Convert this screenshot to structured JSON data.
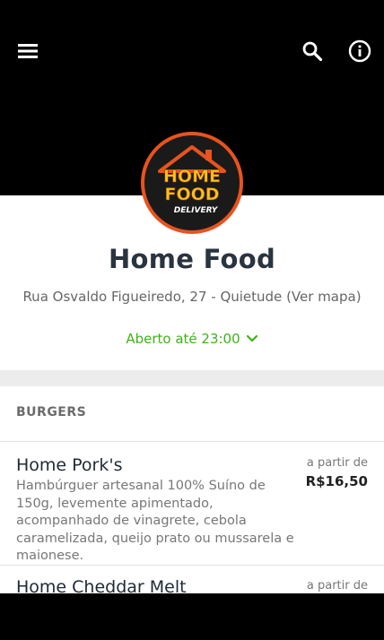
{
  "header": {
    "menu_icon": "hamburger-menu-icon",
    "search_icon": "search-icon",
    "info_icon": "info-icon",
    "logo": {
      "line1": "HOME",
      "line2": "FOOD",
      "line3": "DELIVERY"
    }
  },
  "restaurant": {
    "name": "Home Food",
    "address": "Rua Osvaldo Figueiredo, 27 - Quietude",
    "map_link": "(Ver mapa)",
    "hours": "Aberto até 23:00"
  },
  "section": {
    "title": "BURGERS"
  },
  "items": [
    {
      "name": "Home Pork's",
      "description": "Hambúrguer artesanal 100% Suíno de 150g, levemente apimentado, acompanhado de vinagrete, cebola caramelizada, queijo prato ou mussarela e maionese.",
      "price_prefix": "a partir de",
      "price": "R$16,50"
    },
    {
      "name": "Home Cheddar Melt",
      "price_prefix": "a partir de"
    }
  ],
  "colors": {
    "header_bg": "#000000",
    "accent_green": "#3fb219",
    "logo_orange": "#e8531f",
    "logo_yellow": "#f6c21a"
  }
}
